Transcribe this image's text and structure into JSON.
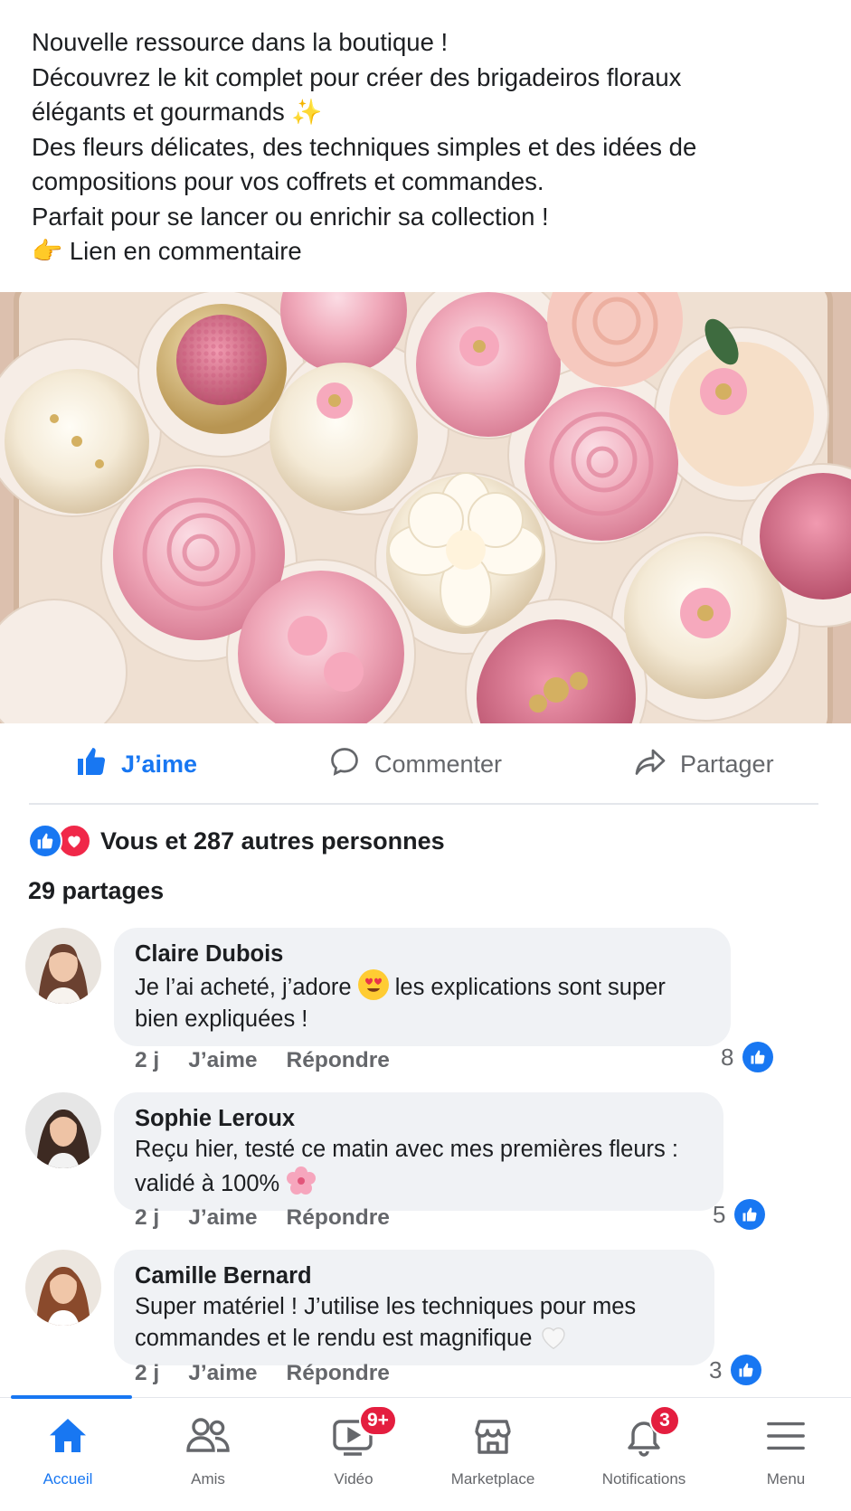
{
  "post": {
    "text_lines": [
      "Nouvelle ressource dans la boutique !",
      "Découvrez le kit complet pour créer des brigadeiros floraux",
      "élégants et gourmands",
      "Des fleurs délicates, des techniques simples et des idées de",
      "compositions pour vos coffrets et commandes.",
      "Parfait pour se lancer ou enrichir sa collection !",
      "Lien en commentaire"
    ],
    "sparkle_emoji": "✨",
    "point_emoji": "👉"
  },
  "actions": {
    "like_label": "J’aime",
    "comment_label": "Commenter",
    "share_label": "Partager"
  },
  "reactions": {
    "summary": "Vous et 287 autres personnes",
    "shares": "29 partages"
  },
  "comments": [
    {
      "name": "Claire Dubois",
      "text_before": "Je l’ai acheté, j’adore",
      "emoji": "heart-eyes",
      "text_after": " les explications sont super",
      "text_line2": "bien expliquées !",
      "time": "2 j",
      "like_label": "J’aime",
      "reply_label": "Répondre",
      "likes": "8"
    },
    {
      "name": "Sophie Leroux",
      "text_line1": "Reçu hier, testé ce matin avec mes premières fleurs :",
      "text_line2": "validé à 100%",
      "emoji": "cherry-blossom",
      "time": "2 j",
      "like_label": "J’aime",
      "reply_label": "Répondre",
      "likes": "5"
    },
    {
      "name": "Camille Bernard",
      "text_line1": "Super matériel ! J’utilise les techniques pour mes",
      "text_line2": "commandes et le rendu est magnifique",
      "emoji": "white-heart",
      "time": "2 j",
      "like_label": "J’aime",
      "reply_label": "Répondre",
      "likes": "3"
    }
  ],
  "tabbar": {
    "home": "Accueil",
    "friends": "Amis",
    "video": "Vidéo",
    "video_badge": "9+",
    "marketplace": "Marketplace",
    "notifications": "Notifications",
    "notifications_badge": "3",
    "menu": "Menu"
  },
  "colors": {
    "brand_blue": "#1877f2",
    "heart_red": "#f02849",
    "badge_red": "#e41e3f",
    "bubble_gray": "#f0f2f5",
    "meta_gray": "#65676b"
  }
}
